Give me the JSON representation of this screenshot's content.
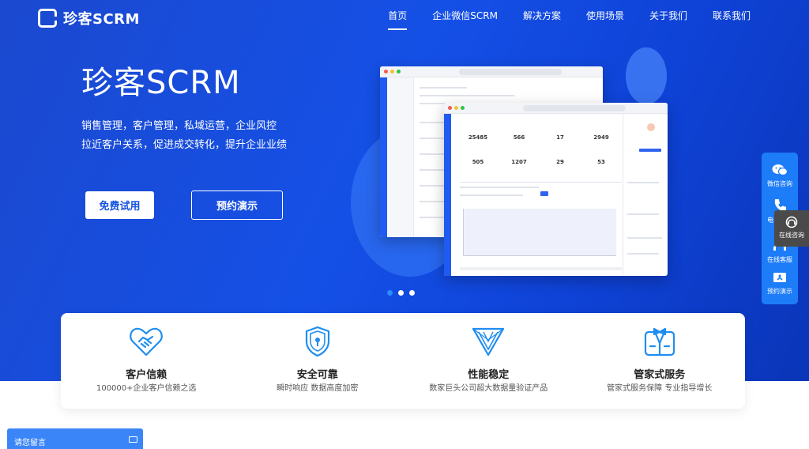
{
  "nav": {
    "logo": "珍客SCRM",
    "items": [
      "首页",
      "企业微信SCRM",
      "解决方案",
      "使用场景",
      "关于我们",
      "联系我们"
    ]
  },
  "hero": {
    "title": "珍客SCRM",
    "subtitle_line1": "销售管理，客户管理，私域运营，企业风控",
    "subtitle_line2": "拉近客户关系，促进成交转化，提升企业业绩",
    "btn_trial": "免费试用",
    "btn_demo": "预约演示"
  },
  "mock_stats": [
    {
      "value": "25485"
    },
    {
      "value": "566"
    },
    {
      "value": "17"
    },
    {
      "value": "2949"
    },
    {
      "value": "505"
    },
    {
      "value": "1207"
    },
    {
      "value": "29"
    },
    {
      "value": "53"
    }
  ],
  "pager": {
    "count": 3,
    "active": 0
  },
  "features": [
    {
      "icon": "handshake-heart-icon",
      "title": "客户信赖",
      "desc": "100000+企业客户信赖之选"
    },
    {
      "icon": "shield-lock-icon",
      "title": "安全可靠",
      "desc": "瞬时响应 数据高度加密"
    },
    {
      "icon": "triangle-stable-icon",
      "title": "性能稳定",
      "desc": "数家巨头公司超大数据量验证产品"
    },
    {
      "icon": "butler-suit-icon",
      "title": "管家式服务",
      "desc": "管家式服务保障 专业指导增长"
    }
  ],
  "float_bar": {
    "wechat": "微信咨询",
    "phone": "电话咨询",
    "service": "在线客服",
    "demo": "预约演示"
  },
  "online_popup": "在线咨询",
  "message_box": "请您留言",
  "colors": {
    "brand": "#1553e0",
    "accent": "#1d7cf8"
  }
}
